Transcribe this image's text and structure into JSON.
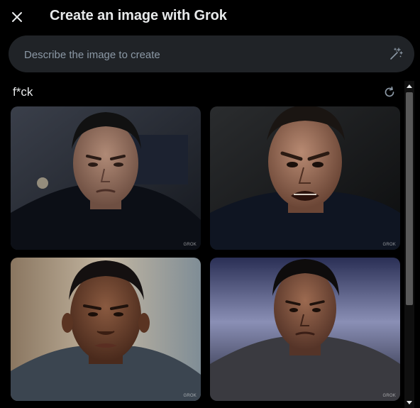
{
  "header": {
    "title": "Create an image with Grok",
    "close_icon": "close-icon"
  },
  "prompt": {
    "placeholder": "Describe the image to create",
    "value": "",
    "wand_icon": "magic-wand-icon"
  },
  "result": {
    "label": "f*ck",
    "refresh_icon": "refresh-icon"
  },
  "images": [
    {
      "watermark": "GROK"
    },
    {
      "watermark": "GROK"
    },
    {
      "watermark": "GROK"
    },
    {
      "watermark": "GROK"
    }
  ],
  "colors": {
    "background": "#000000",
    "input_bg": "#202327",
    "text": "#e7e9ea",
    "placeholder": "#8b98a5"
  }
}
